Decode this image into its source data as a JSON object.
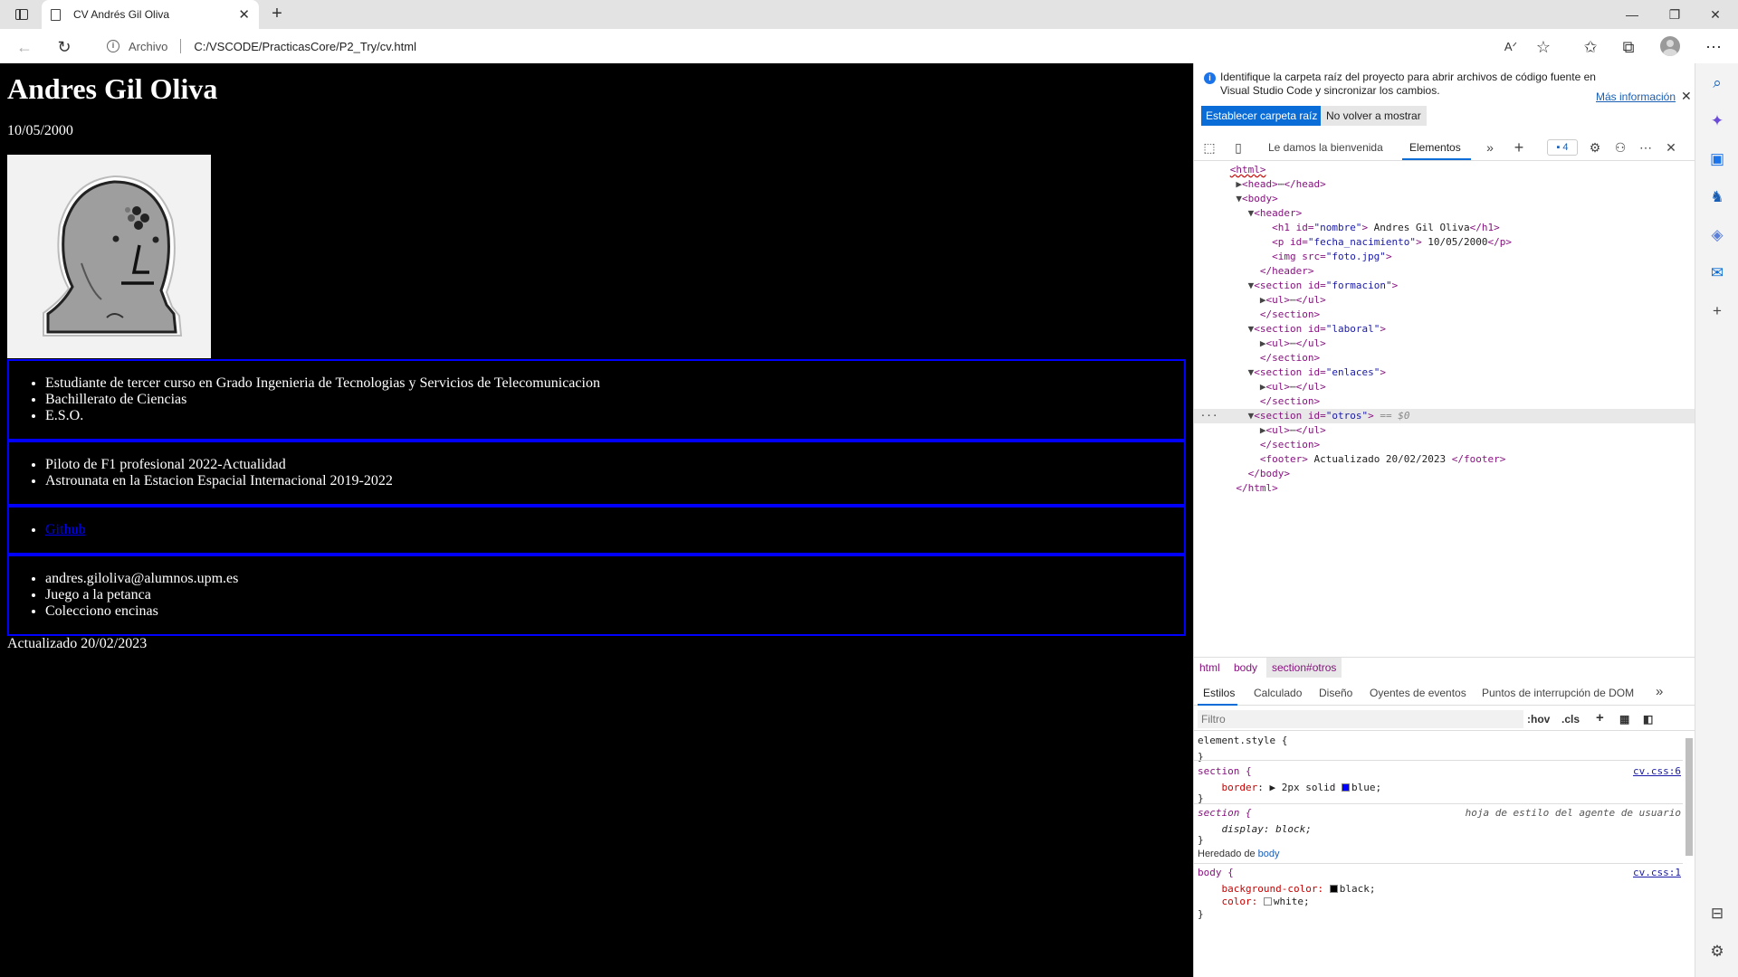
{
  "browser": {
    "tab_title": "CV Andrés Gil Oliva",
    "address_scheme": "Archivo",
    "address_url": "C:/VSCODE/PracticasCore/P2_Try/cv.html"
  },
  "page": {
    "name": "Andres Gil Oliva",
    "birth_date": "10/05/2000",
    "formacion": [
      "Estudiante de tercer curso en Grado Ingenieria de Tecnologias y Servicios de Telecomunicacion",
      "Bachillerato de Ciencias",
      "E.S.O."
    ],
    "laboral": [
      "Piloto de F1 profesional 2022-Actualidad",
      "Astrounata en la Estacion Espacial Internacional 2019-2022"
    ],
    "enlaces": [
      "Github"
    ],
    "otros": [
      "andres.giloliva@alumnos.upm.es",
      "Juego a la petanca",
      "Colecciono encinas"
    ],
    "footer": "Actualizado 20/02/2023"
  },
  "devtools": {
    "infobar_message": "Identifique la carpeta raíz del proyecto para abrir archivos de código fuente en Visual Studio Code y sincronizar los cambios.",
    "infobar_more": "Más información",
    "infobar_primary": "Establecer carpeta raíz",
    "infobar_secondary": "No volver a mostrar",
    "tabs": [
      "Le damos la bienvenida",
      "Elementos"
    ],
    "issues_count": "4",
    "breadcrumbs": [
      "html",
      "body",
      "section#otros"
    ],
    "styles_tabs": [
      "Estilos",
      "Calculado",
      "Diseño",
      "Oyentes de eventos",
      "Puntos de interrupción de DOM"
    ],
    "filter_placeholder": "Filtro",
    "filter_hov": ":hov",
    "filter_cls": ".cls",
    "rules": {
      "element_style": "element.style {",
      "close": "}",
      "section_sel": "section {",
      "section_src": "cv.css:6",
      "section_prop": "border",
      "section_val": "2px solid",
      "section_color": "blue;",
      "ua_sel": "section {",
      "ua_src": "hoja de estilo del agente de usuario",
      "ua_prop": "display: block;",
      "inherited_label": "Heredado de",
      "inherited_from": "body",
      "body_sel": "body {",
      "body_src": "cv.css:1",
      "body_bg_prop": "background-color:",
      "body_bg_val": "black;",
      "body_color_prop": "color:",
      "body_color_val": "white;"
    },
    "dom": {
      "html_open": "<html>",
      "head": "<head>",
      "head_close": "</head>",
      "body_open": "<body>",
      "header_open": "<header>",
      "h1_open": "<h1 id=",
      "h1_id": "\"nombre\"",
      "h1_text": " Andres Gil Oliva",
      "h1_close": "</h1>",
      "p_open": "<p id=",
      "p_id": "\"fecha_nacimiento\"",
      "p_text": " 10/05/2000",
      "p_close": "</p>",
      "img_open": "<img src=",
      "img_src": "\"foto.jpg\"",
      "header_close": "</header>",
      "section_open": "<section id=",
      "section_formacion": "\"formacion\"",
      "section_laboral": "\"laboral\"",
      "section_enlaces": "\"enlaces\"",
      "section_otros": "\"otros\"",
      "ul": "<ul>",
      "ul_close": "</ul>",
      "section_close": "</section>",
      "footer_open": "<footer>",
      "footer_text": " Actualizado 20/02/2023 ",
      "footer_close": "</footer>",
      "body_close": "</body>",
      "html_close": "</html>",
      "selected_marker": "== $0",
      "ellipsis": "⋯"
    }
  },
  "colors": {
    "page_bg": "#000000",
    "section_border": "#0000ff",
    "accent": "#0a6cd6"
  }
}
